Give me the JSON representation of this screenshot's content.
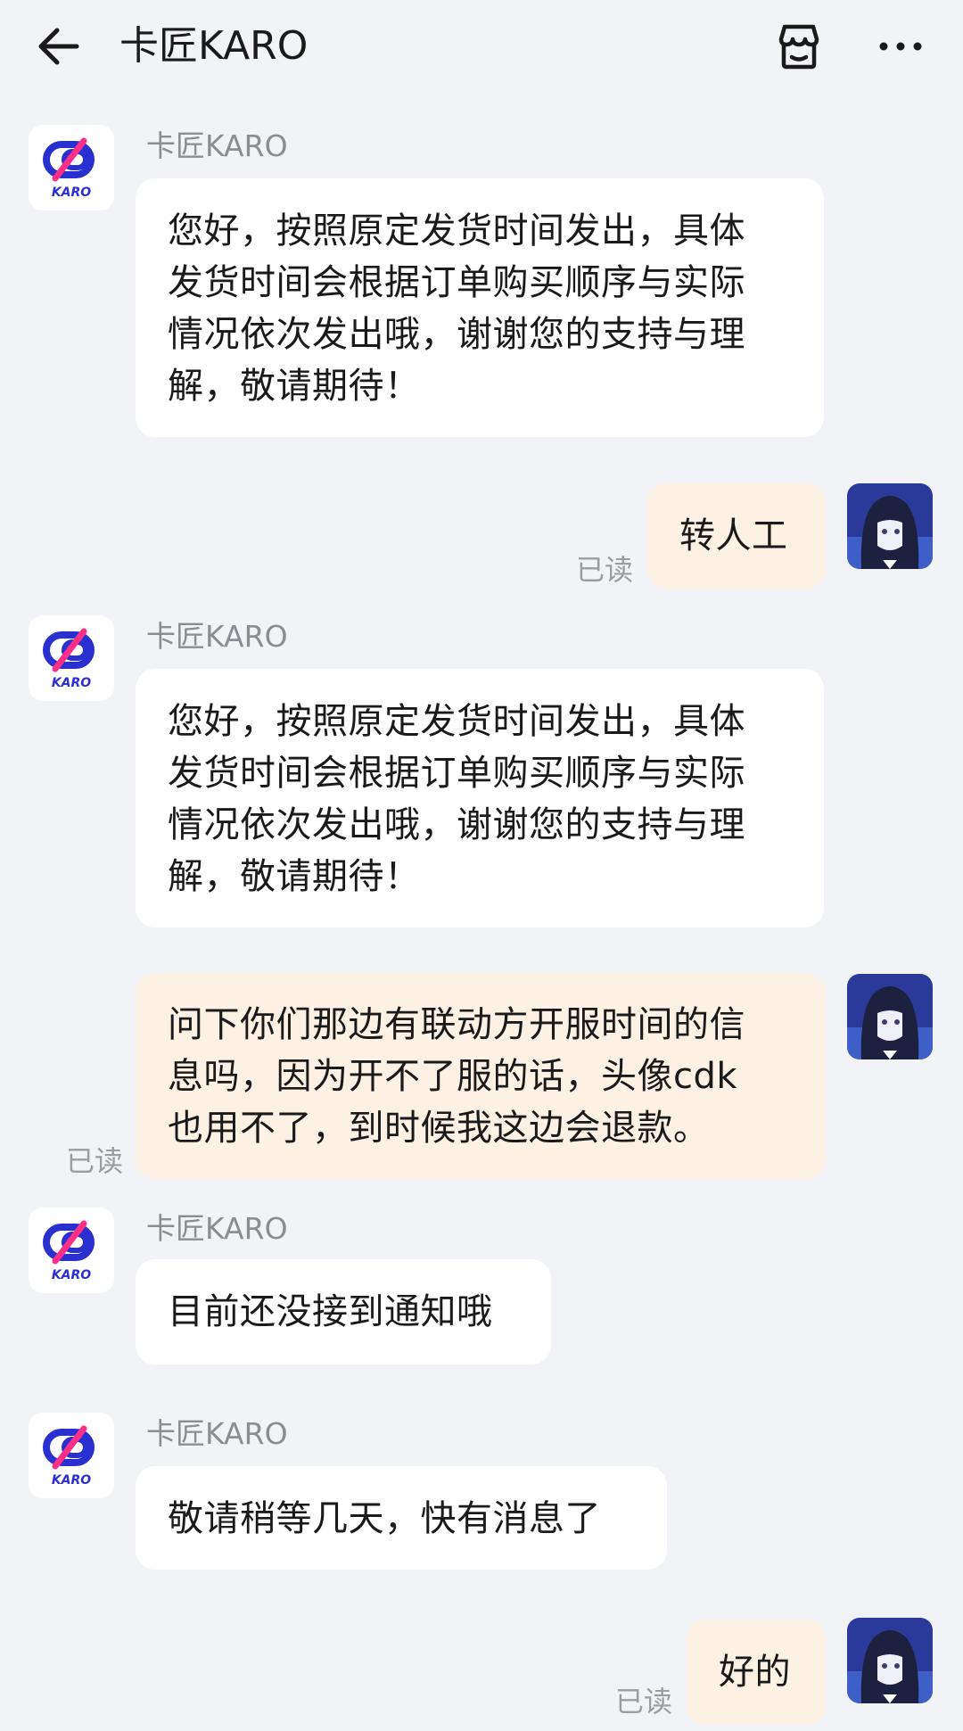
{
  "header": {
    "title": "卡匠KARO",
    "back_icon": "arrow-left-icon",
    "store_icon": "store-icon",
    "more_icon": "more-dots-icon"
  },
  "shop": {
    "name": "卡匠KARO",
    "logo_text": "KARO",
    "logo_colors": {
      "blue": "#2a2fd0",
      "pink": "#ff2f88"
    }
  },
  "colors": {
    "background": "#f2f3f6",
    "incoming_bubble": "#ffffff",
    "outgoing_bubble": "#fcf1e2",
    "muted_text": "#8a8d93"
  },
  "messages": [
    {
      "from": "shop",
      "sender": "卡匠KARO",
      "lines": [
        "您好，按照原定发货时间发出，具体",
        "发货时间会根据订单购买顺序与实际",
        "情况依次发出哦，谢谢您的支持与理",
        "解，敬请期待！"
      ]
    },
    {
      "from": "user",
      "lines": [
        "转人工"
      ],
      "status": "已读"
    },
    {
      "from": "shop",
      "sender": "卡匠KARO",
      "lines": [
        "您好，按照原定发货时间发出，具体",
        "发货时间会根据订单购买顺序与实际",
        "情况依次发出哦，谢谢您的支持与理",
        "解，敬请期待！"
      ]
    },
    {
      "from": "user",
      "lines": [
        "问下你们那边有联动方开服时间的信",
        "息吗，因为开不了服的话，头像cdk",
        "也用不了，到时候我这边会退款。"
      ],
      "status": "已读"
    },
    {
      "from": "shop",
      "sender": "卡匠KARO",
      "lines": [
        "目前还没接到通知哦"
      ]
    },
    {
      "from": "shop",
      "sender": "卡匠KARO",
      "lines": [
        "敬请稍等几天，快有消息了"
      ]
    },
    {
      "from": "user",
      "lines": [
        "好的"
      ],
      "status": "已读"
    }
  ]
}
